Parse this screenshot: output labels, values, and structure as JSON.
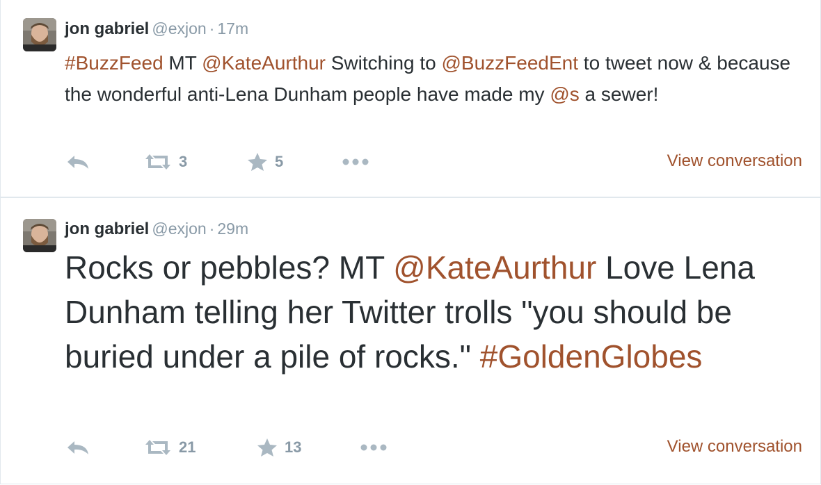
{
  "tweets": [
    {
      "author": {
        "name": "jon gabriel",
        "handle": "@exjon"
      },
      "separator": "·",
      "time": "17m",
      "text_segments": [
        {
          "text": "#BuzzFeed",
          "link": true
        },
        {
          "text": " MT ",
          "link": false
        },
        {
          "text": "@KateAurthur",
          "link": true
        },
        {
          "text": " Switching to ",
          "link": false
        },
        {
          "text": "@BuzzFeedEnt",
          "link": true
        },
        {
          "text": " to tweet now & because the wonderful anti-Lena Dunham people have made my ",
          "link": false
        },
        {
          "text": "@s",
          "link": true
        },
        {
          "text": " a sewer!",
          "link": false
        }
      ],
      "actions": {
        "retweets": "3",
        "favorites": "5"
      },
      "view_conversation": "View conversation"
    },
    {
      "author": {
        "name": "jon gabriel",
        "handle": "@exjon"
      },
      "separator": "·",
      "time": "29m",
      "text_segments": [
        {
          "text": "Rocks or pebbles? MT ",
          "link": false
        },
        {
          "text": "@KateAurthur",
          "link": true
        },
        {
          "text": " Love Lena Dunham telling her Twitter trolls \"you should be buried under a pile of rocks.\" ",
          "link": false
        },
        {
          "text": "#GoldenGlobes",
          "link": true
        }
      ],
      "actions": {
        "retweets": "21",
        "favorites": "13"
      },
      "view_conversation": "View conversation"
    }
  ],
  "icons": {
    "reply": "reply-icon",
    "retweet": "retweet-icon",
    "favorite": "star-icon",
    "more": "more-icon"
  },
  "colors": {
    "link": "#a0522d",
    "text": "#292f33",
    "muted": "#8899a6",
    "icon": "#aab8c2",
    "border": "#e1e8ed"
  }
}
